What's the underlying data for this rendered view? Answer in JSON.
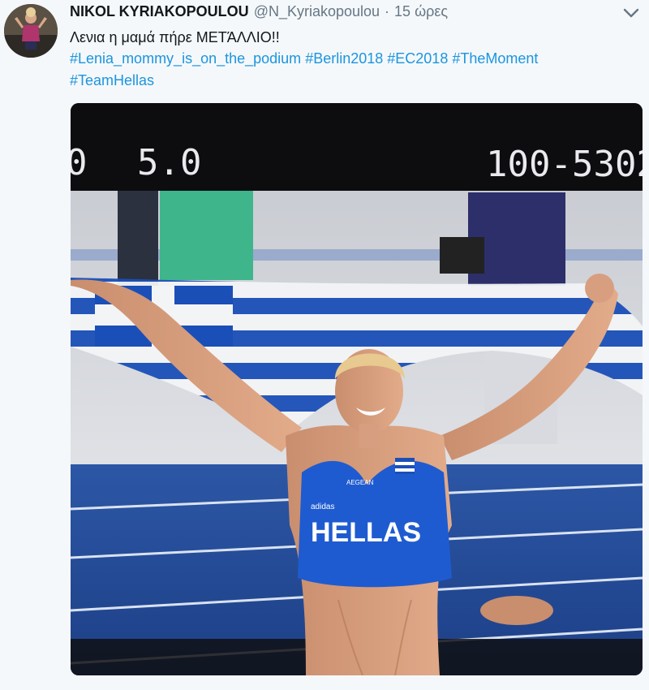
{
  "tweet": {
    "author_name": "NIKOL KYRIAKOPOULOU",
    "handle": "@N_Kyriakopoulou",
    "separator": "·",
    "time": "15 ώρες",
    "text": "Λενια η μαμά πήρε ΜΕΤΆΛΛΙΟ!!",
    "hashtags_line1": [
      "#Lenia_mommy_is_on_the_podium",
      "#Berlin2018",
      "#EC2018",
      "#TheMoment"
    ],
    "hashtags_line2": [
      "#TeamHellas"
    ]
  },
  "media": {
    "scoreboard": {
      "left_digit": "0",
      "score": "5.0",
      "code": "100-5302"
    },
    "jersey": {
      "brand": "adidas",
      "sponsor": "AEGEAN",
      "team": "HELLAS"
    }
  },
  "icons": {
    "caret": "chevron-down-icon"
  },
  "colors": {
    "link": "#1b95e0",
    "secondary_text": "#657786",
    "greek_blue": "#1b4fb8"
  }
}
